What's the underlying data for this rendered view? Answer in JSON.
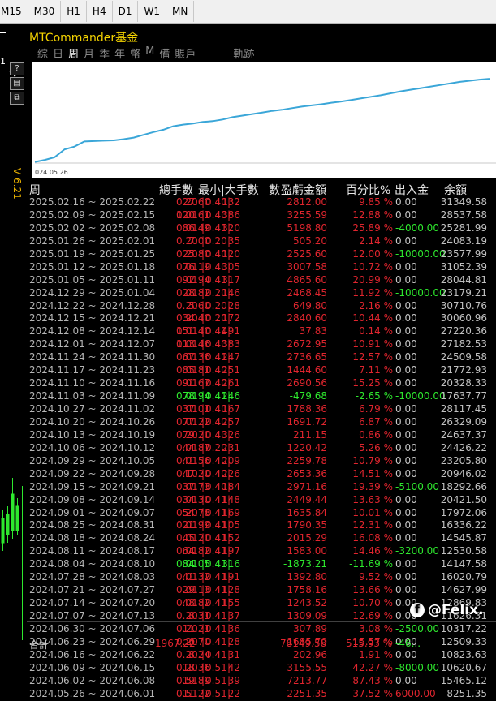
{
  "toolbar": {
    "timeframes": [
      "M15",
      "M30",
      "H1",
      "H4",
      "D1",
      "W1",
      "MN"
    ]
  },
  "left": {
    "price_label": "1",
    "version": "V 6.21"
  },
  "panel": {
    "title": "MTCommander基金",
    "tabs": [
      "綜",
      "日",
      "周",
      "月",
      "季",
      "年",
      "幣",
      "M",
      "備",
      "賬戶",
      "軌跡"
    ],
    "active_tab": "周",
    "chart_date": "024.05.26",
    "curve": [
      10100,
      10600,
      11300,
      13300,
      14000,
      15300,
      15400,
      15500,
      15600,
      15900,
      16300,
      17000,
      17700,
      18300,
      19200,
      19600,
      19900,
      20300,
      20500,
      20900,
      21500,
      21900,
      22300,
      22700,
      23100,
      23400,
      23800,
      24200,
      24500,
      24800,
      25200,
      25500,
      25900,
      26300,
      26700,
      27100,
      27600,
      28100,
      28500,
      28900,
      29300,
      29700,
      30100,
      30500,
      30800,
      31100,
      31300
    ]
  },
  "table": {
    "headers": {
      "period": "周",
      "lots": "總手數",
      "minmax": "最小|大手數",
      "count": "數",
      "pnl": "盈虧金額",
      "pct": "百分比%",
      "flow": "出入金",
      "balance": "余額"
    },
    "rows": [
      {
        "period": "2025.02.16 ~ 2025.02.22",
        "lots": "27.60",
        "min": "0.20",
        "max": "0.40",
        "cnt": "132",
        "pnl": "2812.00",
        "pct": "9.85 %",
        "flow": "0.00",
        "bal": "31349.58",
        "c": "red"
      },
      {
        "period": "2025.02.09 ~ 2025.02.15",
        "lots": "120.61",
        "min": "0.01",
        "max": "0.40",
        "cnt": "386",
        "pnl": "3255.59",
        "pct": "12.88 %",
        "flow": "0.00",
        "bal": "28537.58",
        "c": "red"
      },
      {
        "period": "2025.02.02 ~ 2025.02.08",
        "lots": "86.49",
        "min": "0.01",
        "max": "0.41",
        "cnt": "320",
        "pnl": "5198.80",
        "pct": "25.89 %",
        "flow": "-4000.00",
        "bal": "25281.99",
        "c": "red",
        "fc": "green"
      },
      {
        "period": "2025.01.26 ~ 2025.02.01",
        "lots": "7.00",
        "min": "0.20",
        "max": "0.20",
        "cnt": "35",
        "pnl": "505.20",
        "pct": "2.14 %",
        "flow": "0.00",
        "bal": "24083.19",
        "c": "red"
      },
      {
        "period": "2025.01.19 ~ 2025.01.25",
        "lots": "25.80",
        "min": "0.20",
        "max": "0.40",
        "cnt": "120",
        "pnl": "2525.60",
        "pct": "12.00 %",
        "flow": "-10000.00",
        "bal": "23577.99",
        "c": "red",
        "fc": "green"
      },
      {
        "period": "2025.01.12 ~ 2025.01.18",
        "lots": "76.19",
        "min": "0.01",
        "max": "0.40",
        "cnt": "305",
        "pnl": "3007.58",
        "pct": "10.72 %",
        "flow": "0.00",
        "bal": "31052.39",
        "c": "red"
      },
      {
        "period": "2025.01.05 ~ 2025.01.11",
        "lots": "92.94",
        "min": "0.01",
        "max": "0.41",
        "cnt": "317",
        "pnl": "4865.60",
        "pct": "20.99 %",
        "flow": "0.00",
        "bal": "28044.81",
        "c": "red"
      },
      {
        "period": "2024.12.29 ~ 2025.01.04",
        "lots": "28.82",
        "min": "0.01",
        "max": "0.20",
        "cnt": "146",
        "pnl": "2468.45",
        "pct": "11.92 %",
        "flow": "-10000.00",
        "bal": "23179.21",
        "c": "red",
        "fc": "green"
      },
      {
        "period": "2024.12.22 ~ 2024.12.28",
        "lots": "5.60",
        "min": "0.20",
        "max": "0.20",
        "cnt": "28",
        "pnl": "649.80",
        "pct": "2.16 %",
        "flow": "0.00",
        "bal": "30710.76",
        "c": "red"
      },
      {
        "period": "2024.12.15 ~ 2024.12.21",
        "lots": "34.40",
        "min": "0.20",
        "max": "0.20",
        "cnt": "172",
        "pnl": "2840.60",
        "pct": "10.44 %",
        "flow": "0.00",
        "bal": "30060.96",
        "c": "red"
      },
      {
        "period": "2024.12.08 ~ 2024.12.14",
        "lots": "151.40",
        "min": "0.01",
        "max": "0.41",
        "cnt": "491",
        "pnl": "37.83",
        "pct": "0.14 %",
        "flow": "0.00",
        "bal": "27220.36",
        "c": "red"
      },
      {
        "period": "2024.12.01 ~ 2024.12.07",
        "lots": "113.46",
        "min": "0.01",
        "max": "0.40",
        "cnt": "383",
        "pnl": "2672.95",
        "pct": "10.91 %",
        "flow": "0.00",
        "bal": "27182.53",
        "c": "red"
      },
      {
        "period": "2024.11.24 ~ 2024.11.30",
        "lots": "67.36",
        "min": "0.01",
        "max": "0.41",
        "cnt": "247",
        "pnl": "2736.65",
        "pct": "12.57 %",
        "flow": "0.00",
        "bal": "24509.58",
        "c": "red"
      },
      {
        "period": "2024.11.17 ~ 2024.11.23",
        "lots": "85.81",
        "min": "0.01",
        "max": "0.40",
        "cnt": "251",
        "pnl": "1444.60",
        "pct": "7.11 %",
        "flow": "0.00",
        "bal": "21772.93",
        "c": "red"
      },
      {
        "period": "2024.11.10 ~ 2024.11.16",
        "lots": "91.67",
        "min": "0.01",
        "max": "0.40",
        "cnt": "261",
        "pnl": "2690.56",
        "pct": "15.25 %",
        "flow": "0.00",
        "bal": "20328.33",
        "c": "red"
      },
      {
        "period": "2024.11.03 ~ 2024.11.09",
        "lots": "78.94",
        "min": "0.01",
        "max": "0.41",
        "cnt": "246",
        "pnl": "-479.68",
        "pct": "-2.65 %",
        "flow": "-10000.00",
        "bal": "17637.77",
        "c": "green",
        "fc": "green"
      },
      {
        "period": "2024.10.27 ~ 2024.11.02",
        "lots": "37.01",
        "min": "0.01",
        "max": "0.40",
        "cnt": "167",
        "pnl": "1788.36",
        "pct": "6.79 %",
        "flow": "0.00",
        "bal": "28117.45",
        "c": "red"
      },
      {
        "period": "2024.10.20 ~ 2024.10.26",
        "lots": "77.22",
        "min": "0.01",
        "max": "0.40",
        "cnt": "257",
        "pnl": "1691.72",
        "pct": "6.87 %",
        "flow": "0.00",
        "bal": "26329.09",
        "c": "red"
      },
      {
        "period": "2024.10.13 ~ 2024.10.19",
        "lots": "79.20",
        "min": "0.20",
        "max": "0.40",
        "cnt": "326",
        "pnl": "211.15",
        "pct": "0.86 %",
        "flow": "0.00",
        "bal": "24637.37",
        "c": "red"
      },
      {
        "period": "2024.10.06 ~ 2024.10.12",
        "lots": "44.87",
        "min": "0.01",
        "max": "0.20",
        "cnt": "231",
        "pnl": "1220.42",
        "pct": "5.26 %",
        "flow": "0.00",
        "bal": "24426.22",
        "c": "red"
      },
      {
        "period": "2024.09.29 ~ 2024.10.05",
        "lots": "41.56",
        "min": "0.01",
        "max": "0.40",
        "cnt": "209",
        "pnl": "2259.78",
        "pct": "10.79 %",
        "flow": "0.00",
        "bal": "23205.80",
        "c": "red"
      },
      {
        "period": "2024.09.22 ~ 2024.09.28",
        "lots": "47.20",
        "min": "0.10",
        "max": "0.40",
        "cnt": "226",
        "pnl": "2653.36",
        "pct": "14.51 %",
        "flow": "0.00",
        "bal": "20946.02",
        "c": "red"
      },
      {
        "period": "2024.09.15 ~ 2024.09.21",
        "lots": "37.73",
        "min": "0.01",
        "max": "0.40",
        "cnt": "184",
        "pnl": "2971.16",
        "pct": "19.39 %",
        "flow": "-5100.00",
        "bal": "18292.66",
        "c": "red",
        "fc": "green"
      },
      {
        "period": "2024.09.08 ~ 2024.09.14",
        "lots": "34.30",
        "min": "0.01",
        "max": "0.41",
        "cnt": "148",
        "pnl": "2449.44",
        "pct": "13.63 %",
        "flow": "0.00",
        "bal": "20421.50",
        "c": "red"
      },
      {
        "period": "2024.09.01 ~ 2024.09.07",
        "lots": "54.78",
        "min": "0.20",
        "max": "0.41",
        "cnt": "169",
        "pnl": "1635.84",
        "pct": "10.01 %",
        "flow": "0.00",
        "bal": "17972.06",
        "c": "red"
      },
      {
        "period": "2024.08.25 ~ 2024.08.31",
        "lots": "21.99",
        "min": "0.01",
        "max": "0.41",
        "cnt": "105",
        "pnl": "1790.35",
        "pct": "12.31 %",
        "flow": "0.00",
        "bal": "16336.22",
        "c": "red"
      },
      {
        "period": "2024.08.18 ~ 2024.08.24",
        "lots": "45.20",
        "min": "0.01",
        "max": "0.41",
        "cnt": "152",
        "pnl": "2015.29",
        "pct": "16.08 %",
        "flow": "0.00",
        "bal": "14545.87",
        "c": "red"
      },
      {
        "period": "2024.08.11 ~ 2024.08.17",
        "lots": "64.82",
        "min": "0.01",
        "max": "0.41",
        "cnt": "197",
        "pnl": "1583.00",
        "pct": "14.46 %",
        "flow": "-3200.00",
        "bal": "12530.58",
        "c": "red",
        "fc": "green"
      },
      {
        "period": "2024.08.04 ~ 2024.08.10",
        "lots": "84.05",
        "min": "0.01",
        "max": "0.41",
        "cnt": "316",
        "pnl": "-1873.21",
        "pct": "-11.69 %",
        "flow": "0.00",
        "bal": "14147.58",
        "c": "green"
      },
      {
        "period": "2024.07.28 ~ 2024.08.03",
        "lots": "41.32",
        "min": "0.01",
        "max": "0.41",
        "cnt": "191",
        "pnl": "1392.80",
        "pct": "9.52 %",
        "flow": "0.00",
        "bal": "16020.79",
        "c": "red"
      },
      {
        "period": "2024.07.21 ~ 2024.07.27",
        "lots": "29.13",
        "min": "0.01",
        "max": "0.41",
        "cnt": "128",
        "pnl": "1758.16",
        "pct": "13.66 %",
        "flow": "0.00",
        "bal": "14627.99",
        "c": "red"
      },
      {
        "period": "2024.07.14 ~ 2024.07.20",
        "lots": "48.82",
        "min": "0.01",
        "max": "0.41",
        "cnt": "155",
        "pnl": "1243.52",
        "pct": "10.70 %",
        "flow": "0.00",
        "bal": "12869.83",
        "c": "red"
      },
      {
        "period": "2024.07.07 ~ 2024.07.13",
        "lots": "8.31",
        "min": "0.20",
        "max": "0.41",
        "cnt": "37",
        "pnl": "1309.09",
        "pct": "12.69 %",
        "flow": "0.00",
        "bal": "11626.31",
        "c": "red"
      },
      {
        "period": "2024.06.30 ~ 2024.07.06",
        "lots": "11.21",
        "min": "0.20",
        "max": "0.41",
        "cnt": "36",
        "pnl": "307.89",
        "pct": "3.08 %",
        "flow": "-2500.00",
        "bal": "10317.22",
        "c": "red",
        "fc": "green"
      },
      {
        "period": "2024.06.23 ~ 2024.06.29",
        "lots": "6.70",
        "min": "0.20",
        "max": "0.41",
        "cnt": "28",
        "pnl": "1685.70",
        "pct": "15.57 %",
        "flow": "0.00",
        "bal": "12509.33",
        "c": "red"
      },
      {
        "period": "2024.06.16 ~ 2024.06.22",
        "lots": "8.24",
        "min": "0.20",
        "max": "0.41",
        "cnt": "31",
        "pnl": "202.96",
        "pct": "1.91 %",
        "flow": "0.00",
        "bal": "10823.63",
        "c": "red"
      },
      {
        "period": "2024.06.09 ~ 2024.06.15",
        "lots": "18.36",
        "min": "0.20",
        "max": "0.51",
        "cnt": "42",
        "pnl": "3155.55",
        "pct": "42.27 %",
        "flow": "-8000.00",
        "bal": "10620.67",
        "c": "red",
        "fc": "green"
      },
      {
        "period": "2024.06.02 ~ 2024.06.08",
        "lots": "19.89",
        "min": "0.51",
        "max": "0.51",
        "cnt": "39",
        "pnl": "7213.77",
        "pct": "87.43 %",
        "flow": "0.00",
        "bal": "15465.12",
        "c": "red"
      },
      {
        "period": "2024.05.26 ~ 2024.06.01",
        "lots": "11.22",
        "min": "0.51",
        "max": "0.51",
        "cnt": "22",
        "pnl": "2251.35",
        "pct": "37.52 %",
        "flow": "6000.00",
        "bal": "8251.35",
        "c": "red",
        "fc": "red"
      }
    ],
    "total": {
      "label": "合計",
      "lots": "1967.22",
      "pnl": "78149.58",
      "pct": "515.93 %",
      "flow": "-46..."
    }
  },
  "watermark": {
    "icon": "facebook-icon",
    "text": "@Felix."
  },
  "colors": {
    "positive": "#e0252e",
    "negative": "#2ee82e",
    "title": "#f5d400",
    "curve": "#3aa6d8"
  }
}
